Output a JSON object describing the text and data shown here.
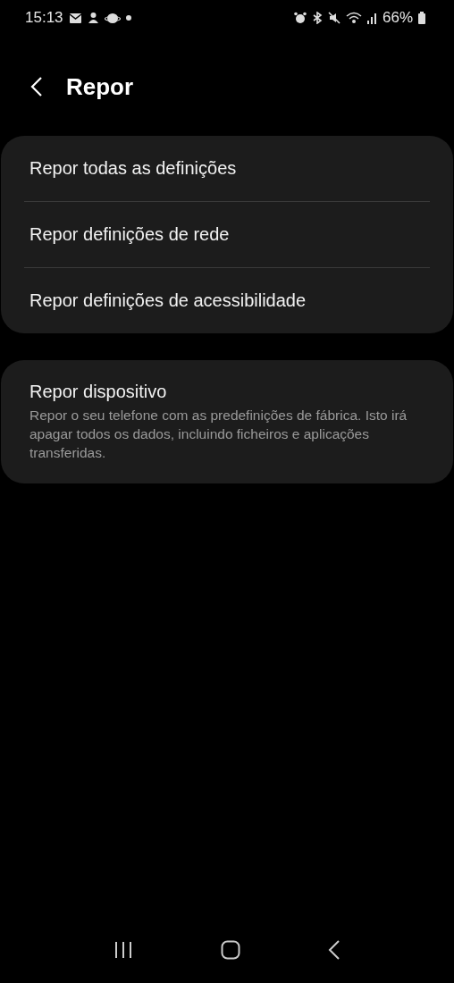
{
  "status_bar": {
    "time": "15:13",
    "battery": "66%"
  },
  "header": {
    "title": "Repor"
  },
  "groups": [
    {
      "items": [
        {
          "title": "Repor todas as definições"
        },
        {
          "title": "Repor definições de rede"
        },
        {
          "title": "Repor definições de acessibilidade"
        }
      ]
    },
    {
      "items": [
        {
          "title": "Repor dispositivo",
          "description": "Repor o seu telefone com as predefinições de fábrica. Isto irá apagar todos os dados, incluindo ficheiros e aplicações transferidas."
        }
      ]
    }
  ]
}
